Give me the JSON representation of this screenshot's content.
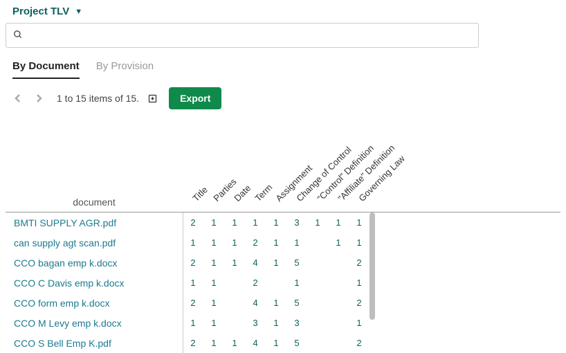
{
  "project": {
    "name": "Project TLV"
  },
  "tabs": [
    {
      "label": "By Document",
      "active": true
    },
    {
      "label": "By Provision",
      "active": false
    }
  ],
  "toolbar": {
    "range": "1 to 15 items of 15.",
    "export_label": "Export"
  },
  "search": {
    "placeholder": ""
  },
  "columns": [
    "Title",
    "Parties",
    "Date",
    "Term",
    "Assignment",
    "Change of Control",
    "\"Control\" Definition",
    "\"Affiliate\" Definition",
    "Governing Law"
  ],
  "doc_header": "document",
  "rows": [
    {
      "doc": "BMTI SUPPLY AGR.pdf",
      "v": [
        "2",
        "1",
        "1",
        "1",
        "1",
        "3",
        "1",
        "1",
        "1"
      ]
    },
    {
      "doc": "can supply agt scan.pdf",
      "v": [
        "1",
        "1",
        "1",
        "2",
        "1",
        "1",
        "",
        "1",
        "1"
      ]
    },
    {
      "doc": "CCO bagan emp k.docx",
      "v": [
        "2",
        "1",
        "1",
        "4",
        "1",
        "5",
        "",
        "",
        "2"
      ]
    },
    {
      "doc": "CCO C Davis emp k.docx",
      "v": [
        "1",
        "1",
        "",
        "2",
        "",
        "1",
        "",
        "",
        "1"
      ]
    },
    {
      "doc": "CCO form emp k.docx",
      "v": [
        "2",
        "1",
        "",
        "4",
        "1",
        "5",
        "",
        "",
        "2"
      ]
    },
    {
      "doc": "CCO M Levy emp k.docx",
      "v": [
        "1",
        "1",
        "",
        "3",
        "1",
        "3",
        "",
        "",
        "1"
      ]
    },
    {
      "doc": "CCO S Bell Emp K.pdf",
      "v": [
        "2",
        "1",
        "1",
        "4",
        "1",
        "5",
        "",
        "",
        "2"
      ]
    }
  ]
}
